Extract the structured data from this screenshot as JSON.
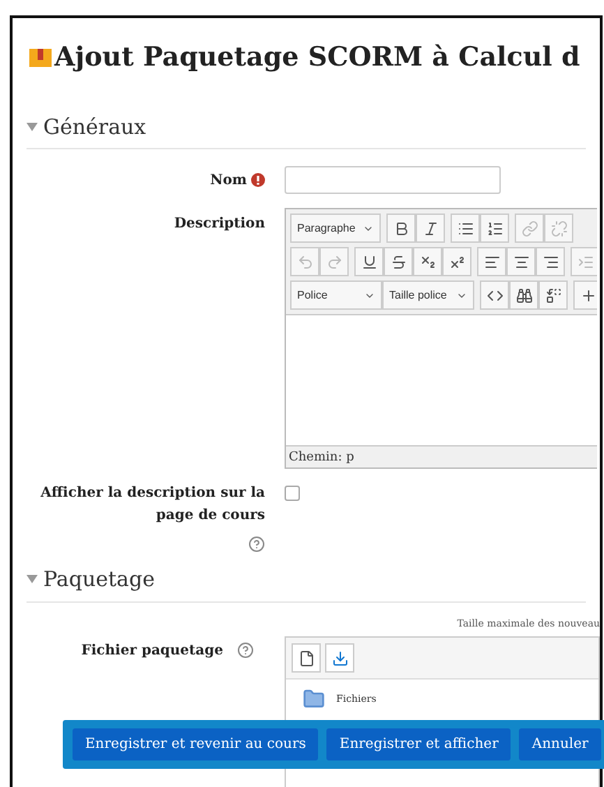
{
  "page_title": "Ajout Paquetage SCORM à Calcul d",
  "general_section": {
    "heading": "Généraux",
    "expanded": true,
    "fields": [
      {
        "kind": "text",
        "label": "Nom",
        "required": true
      },
      {
        "kind": "editor",
        "label": "Description",
        "editor": {
          "block_format": "Paragraphe",
          "font": "Police",
          "font_size": "Taille police",
          "path": "Chemin: p"
        }
      },
      {
        "kind": "checkbox",
        "label": "Afficher la description sur la page de cours",
        "checked": false,
        "help": true
      }
    ]
  },
  "package_section": {
    "heading": "Paquetage",
    "expanded": true,
    "file_field": {
      "label": "Fichier paquetage",
      "help": true,
      "max_size_note": "Taille maximale des nouveau",
      "folder": "Fichiers"
    }
  },
  "footer_buttons": [
    "Enregistrer et revenir au cours",
    "Enregistrer et afficher",
    "Annuler"
  ]
}
